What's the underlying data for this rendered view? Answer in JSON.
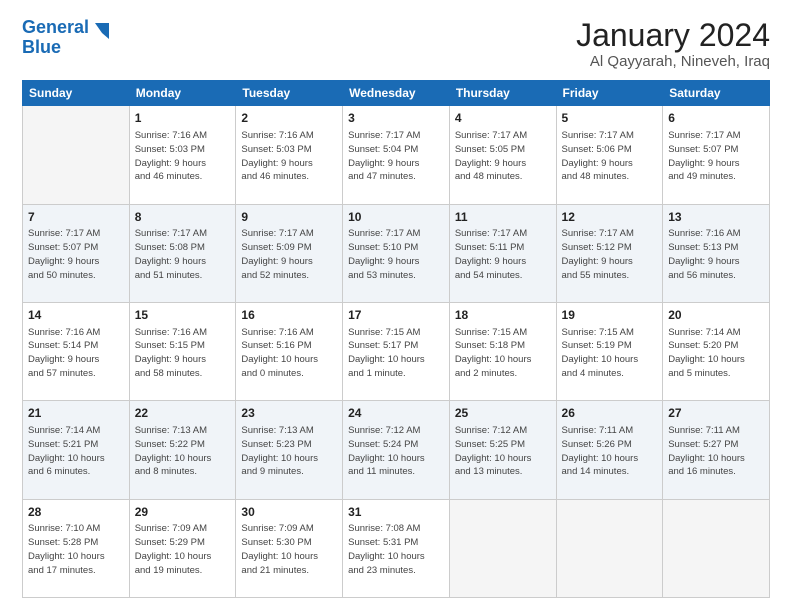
{
  "header": {
    "logo_line1": "General",
    "logo_line2": "Blue",
    "title": "January 2024",
    "subtitle": "Al Qayyarah, Nineveh, Iraq"
  },
  "days_of_week": [
    "Sunday",
    "Monday",
    "Tuesday",
    "Wednesday",
    "Thursday",
    "Friday",
    "Saturday"
  ],
  "weeks": [
    [
      {
        "num": "",
        "info": ""
      },
      {
        "num": "1",
        "info": "Sunrise: 7:16 AM\nSunset: 5:03 PM\nDaylight: 9 hours\nand 46 minutes."
      },
      {
        "num": "2",
        "info": "Sunrise: 7:16 AM\nSunset: 5:03 PM\nDaylight: 9 hours\nand 46 minutes."
      },
      {
        "num": "3",
        "info": "Sunrise: 7:17 AM\nSunset: 5:04 PM\nDaylight: 9 hours\nand 47 minutes."
      },
      {
        "num": "4",
        "info": "Sunrise: 7:17 AM\nSunset: 5:05 PM\nDaylight: 9 hours\nand 48 minutes."
      },
      {
        "num": "5",
        "info": "Sunrise: 7:17 AM\nSunset: 5:06 PM\nDaylight: 9 hours\nand 48 minutes."
      },
      {
        "num": "6",
        "info": "Sunrise: 7:17 AM\nSunset: 5:07 PM\nDaylight: 9 hours\nand 49 minutes."
      }
    ],
    [
      {
        "num": "7",
        "info": "Sunrise: 7:17 AM\nSunset: 5:07 PM\nDaylight: 9 hours\nand 50 minutes."
      },
      {
        "num": "8",
        "info": "Sunrise: 7:17 AM\nSunset: 5:08 PM\nDaylight: 9 hours\nand 51 minutes."
      },
      {
        "num": "9",
        "info": "Sunrise: 7:17 AM\nSunset: 5:09 PM\nDaylight: 9 hours\nand 52 minutes."
      },
      {
        "num": "10",
        "info": "Sunrise: 7:17 AM\nSunset: 5:10 PM\nDaylight: 9 hours\nand 53 minutes."
      },
      {
        "num": "11",
        "info": "Sunrise: 7:17 AM\nSunset: 5:11 PM\nDaylight: 9 hours\nand 54 minutes."
      },
      {
        "num": "12",
        "info": "Sunrise: 7:17 AM\nSunset: 5:12 PM\nDaylight: 9 hours\nand 55 minutes."
      },
      {
        "num": "13",
        "info": "Sunrise: 7:16 AM\nSunset: 5:13 PM\nDaylight: 9 hours\nand 56 minutes."
      }
    ],
    [
      {
        "num": "14",
        "info": "Sunrise: 7:16 AM\nSunset: 5:14 PM\nDaylight: 9 hours\nand 57 minutes."
      },
      {
        "num": "15",
        "info": "Sunrise: 7:16 AM\nSunset: 5:15 PM\nDaylight: 9 hours\nand 58 minutes."
      },
      {
        "num": "16",
        "info": "Sunrise: 7:16 AM\nSunset: 5:16 PM\nDaylight: 10 hours\nand 0 minutes."
      },
      {
        "num": "17",
        "info": "Sunrise: 7:15 AM\nSunset: 5:17 PM\nDaylight: 10 hours\nand 1 minute."
      },
      {
        "num": "18",
        "info": "Sunrise: 7:15 AM\nSunset: 5:18 PM\nDaylight: 10 hours\nand 2 minutes."
      },
      {
        "num": "19",
        "info": "Sunrise: 7:15 AM\nSunset: 5:19 PM\nDaylight: 10 hours\nand 4 minutes."
      },
      {
        "num": "20",
        "info": "Sunrise: 7:14 AM\nSunset: 5:20 PM\nDaylight: 10 hours\nand 5 minutes."
      }
    ],
    [
      {
        "num": "21",
        "info": "Sunrise: 7:14 AM\nSunset: 5:21 PM\nDaylight: 10 hours\nand 6 minutes."
      },
      {
        "num": "22",
        "info": "Sunrise: 7:13 AM\nSunset: 5:22 PM\nDaylight: 10 hours\nand 8 minutes."
      },
      {
        "num": "23",
        "info": "Sunrise: 7:13 AM\nSunset: 5:23 PM\nDaylight: 10 hours\nand 9 minutes."
      },
      {
        "num": "24",
        "info": "Sunrise: 7:12 AM\nSunset: 5:24 PM\nDaylight: 10 hours\nand 11 minutes."
      },
      {
        "num": "25",
        "info": "Sunrise: 7:12 AM\nSunset: 5:25 PM\nDaylight: 10 hours\nand 13 minutes."
      },
      {
        "num": "26",
        "info": "Sunrise: 7:11 AM\nSunset: 5:26 PM\nDaylight: 10 hours\nand 14 minutes."
      },
      {
        "num": "27",
        "info": "Sunrise: 7:11 AM\nSunset: 5:27 PM\nDaylight: 10 hours\nand 16 minutes."
      }
    ],
    [
      {
        "num": "28",
        "info": "Sunrise: 7:10 AM\nSunset: 5:28 PM\nDaylight: 10 hours\nand 17 minutes."
      },
      {
        "num": "29",
        "info": "Sunrise: 7:09 AM\nSunset: 5:29 PM\nDaylight: 10 hours\nand 19 minutes."
      },
      {
        "num": "30",
        "info": "Sunrise: 7:09 AM\nSunset: 5:30 PM\nDaylight: 10 hours\nand 21 minutes."
      },
      {
        "num": "31",
        "info": "Sunrise: 7:08 AM\nSunset: 5:31 PM\nDaylight: 10 hours\nand 23 minutes."
      },
      {
        "num": "",
        "info": ""
      },
      {
        "num": "",
        "info": ""
      },
      {
        "num": "",
        "info": ""
      }
    ]
  ]
}
